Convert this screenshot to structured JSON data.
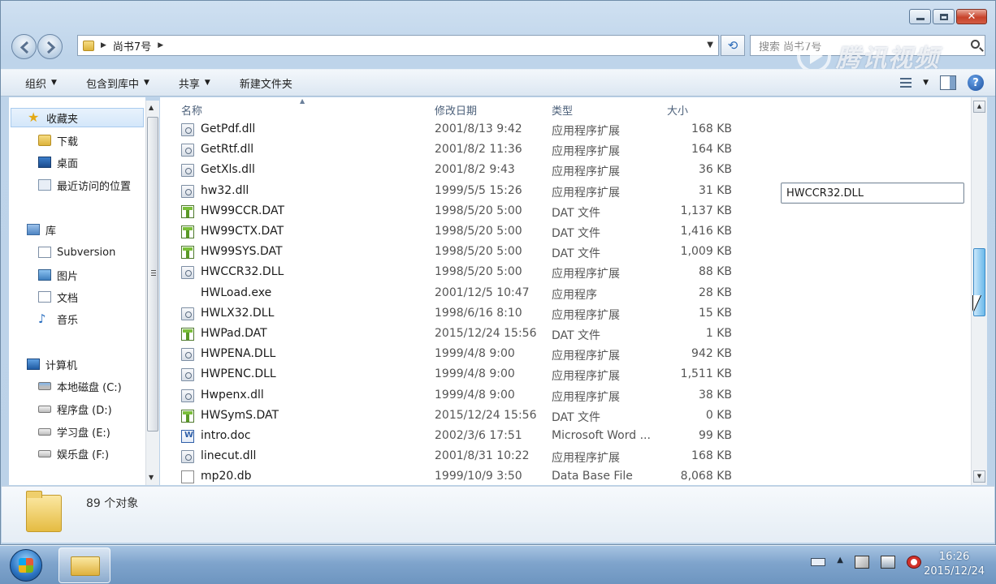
{
  "window": {
    "address": {
      "path_segment": "尚书7号"
    },
    "search": {
      "placeholder": "搜索 尚书7号"
    },
    "watermark": "腾讯视频"
  },
  "toolbar": {
    "items": [
      {
        "label": "组织",
        "has_menu": true
      },
      {
        "label": "包含到库中",
        "has_menu": true
      },
      {
        "label": "共享",
        "has_menu": true
      },
      {
        "label": "新建文件夹",
        "has_menu": false
      }
    ]
  },
  "navpane": {
    "favorites": "收藏夹",
    "fav_items": [
      "下载",
      "桌面",
      "最近访问的位置"
    ],
    "library": "库",
    "lib_items": [
      "Subversion",
      "图片",
      "文档",
      "音乐"
    ],
    "computer": "计算机",
    "drives": [
      "本地磁盘 (C:)",
      "程序盘 (D:)",
      "学习盘 (E:)",
      "娱乐盘 (F:)"
    ]
  },
  "filelist": {
    "columns": {
      "name": "名称",
      "date": "修改日期",
      "type": "类型",
      "size": "大小"
    },
    "rows": [
      {
        "name": "GetPdf.dll",
        "date": "2001/8/13 9:42",
        "type": "应用程序扩展",
        "size": "168 KB",
        "icon": "dll"
      },
      {
        "name": "GetRtf.dll",
        "date": "2001/8/2 11:36",
        "type": "应用程序扩展",
        "size": "164 KB",
        "icon": "dll"
      },
      {
        "name": "GetXls.dll",
        "date": "2001/8/2 9:43",
        "type": "应用程序扩展",
        "size": "36 KB",
        "icon": "dll"
      },
      {
        "name": "hw32.dll",
        "date": "1999/5/5 15:26",
        "type": "应用程序扩展",
        "size": "31 KB",
        "icon": "dll"
      },
      {
        "name": "HW99CCR.DAT",
        "date": "1998/5/20 5:00",
        "type": "DAT 文件",
        "size": "1,137 KB",
        "icon": "dat"
      },
      {
        "name": "HW99CTX.DAT",
        "date": "1998/5/20 5:00",
        "type": "DAT 文件",
        "size": "1,416 KB",
        "icon": "dat"
      },
      {
        "name": "HW99SYS.DAT",
        "date": "1998/5/20 5:00",
        "type": "DAT 文件",
        "size": "1,009 KB",
        "icon": "dat"
      },
      {
        "name": "HWCCR32.DLL",
        "date": "1998/5/20 5:00",
        "type": "应用程序扩展",
        "size": "88 KB",
        "icon": "dll"
      },
      {
        "name": "HWLoad.exe",
        "date": "2001/12/5 10:47",
        "type": "应用程序",
        "size": "28 KB",
        "icon": "exe"
      },
      {
        "name": "HWLX32.DLL",
        "date": "1998/6/16 8:10",
        "type": "应用程序扩展",
        "size": "15 KB",
        "icon": "dll"
      },
      {
        "name": "HWPad.DAT",
        "date": "2015/12/24 15:56",
        "type": "DAT 文件",
        "size": "1 KB",
        "icon": "dat"
      },
      {
        "name": "HWPENA.DLL",
        "date": "1999/4/8 9:00",
        "type": "应用程序扩展",
        "size": "942 KB",
        "icon": "dll"
      },
      {
        "name": "HWPENC.DLL",
        "date": "1999/4/8 9:00",
        "type": "应用程序扩展",
        "size": "1,511 KB",
        "icon": "dll"
      },
      {
        "name": "Hwpenx.dll",
        "date": "1999/4/8 9:00",
        "type": "应用程序扩展",
        "size": "38 KB",
        "icon": "dll"
      },
      {
        "name": "HWSymS.DAT",
        "date": "2015/12/24 15:56",
        "type": "DAT 文件",
        "size": "0 KB",
        "icon": "dat"
      },
      {
        "name": "intro.doc",
        "date": "2002/3/6 17:51",
        "type": "Microsoft Word ...",
        "size": "99 KB",
        "icon": "word"
      },
      {
        "name": "linecut.dll",
        "date": "2001/8/31 10:22",
        "type": "应用程序扩展",
        "size": "168 KB",
        "icon": "dll"
      },
      {
        "name": "mp20.db",
        "date": "1999/10/9 3:50",
        "type": "Data Base File",
        "size": "8,068 KB",
        "icon": "db"
      }
    ],
    "rename_value": "HWCCR32.DLL"
  },
  "details": {
    "count": "89 个对象"
  },
  "taskbar": {
    "time": "16:26",
    "date": "2015/12/24"
  }
}
